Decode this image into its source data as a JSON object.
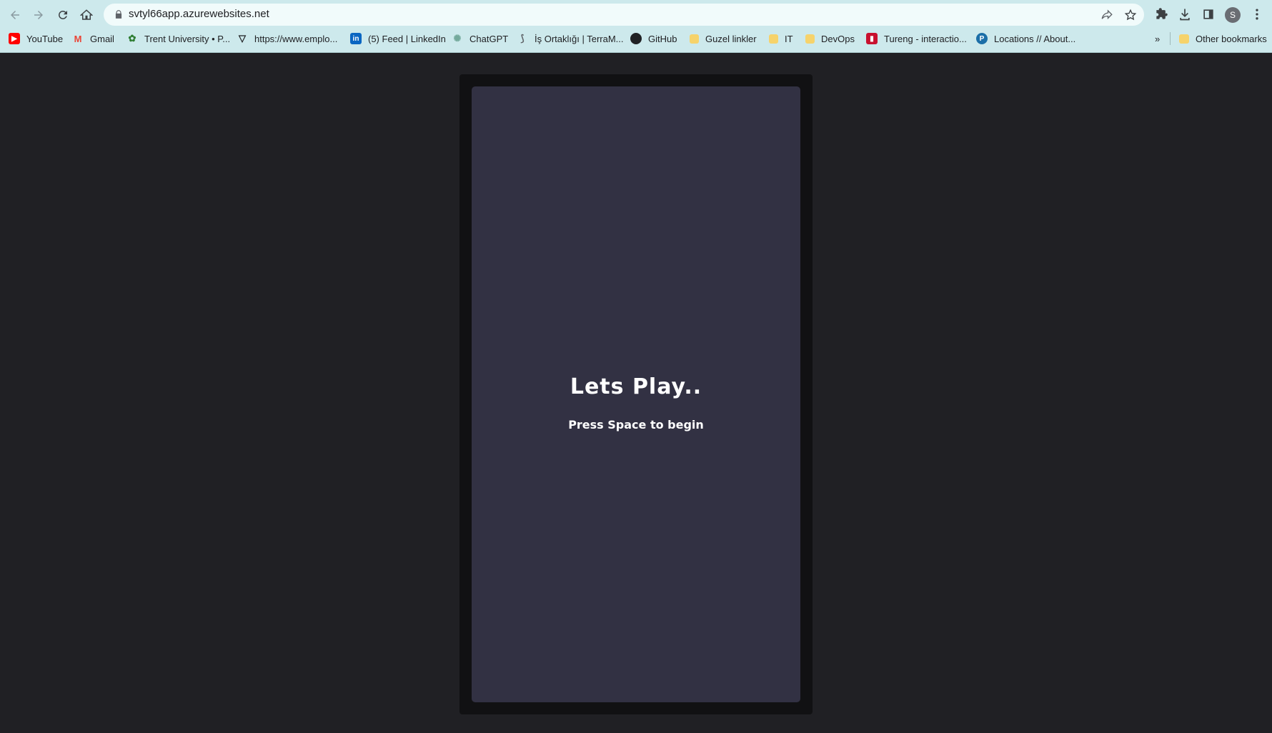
{
  "browser": {
    "url": "svtyl66app.azurewebsites.net",
    "avatar_initial": "S",
    "accent_color": "#cde9ec"
  },
  "bookmarks": [
    {
      "label": "YouTube",
      "icon": "youtube-icon",
      "color": "#ff0000"
    },
    {
      "label": "Gmail",
      "icon": "gmail-icon",
      "color": "#ea4335"
    },
    {
      "label": "Trent University • P...",
      "icon": "globe-icon",
      "color": "#2e7d32"
    },
    {
      "label": "https://www.emplo...",
      "icon": "shield-icon",
      "color": "#202124"
    },
    {
      "label": "(5) Feed | LinkedIn",
      "icon": "linkedin-icon",
      "color": "#0a66c2"
    },
    {
      "label": "ChatGPT",
      "icon": "chatgpt-icon",
      "color": "#74aa9c"
    },
    {
      "label": "İş Ortaklığı | TerraM...",
      "icon": "terra-icon",
      "color": "#5f6368"
    },
    {
      "label": "GitHub",
      "icon": "github-icon",
      "color": "#202124"
    },
    {
      "label": "Guzel linkler",
      "icon": "folder-icon",
      "color": "#f6d36b"
    },
    {
      "label": "IT",
      "icon": "folder-icon",
      "color": "#f6d36b"
    },
    {
      "label": "DevOps",
      "icon": "folder-icon",
      "color": "#f6d36b"
    },
    {
      "label": "Tureng - interactio...",
      "icon": "tureng-icon",
      "color": "#c8102e"
    },
    {
      "label": "Locations // About...",
      "icon": "p-icon",
      "color": "#1b6fa8"
    }
  ],
  "more_bookmarks": "»",
  "other_bookmarks": {
    "label": "Other bookmarks",
    "icon": "folder-icon"
  },
  "game": {
    "title": "Lets Play..",
    "subtitle": "Press Space to begin",
    "canvas_color": "#323143",
    "frame_color": "#111113",
    "page_bg": "#202024"
  }
}
